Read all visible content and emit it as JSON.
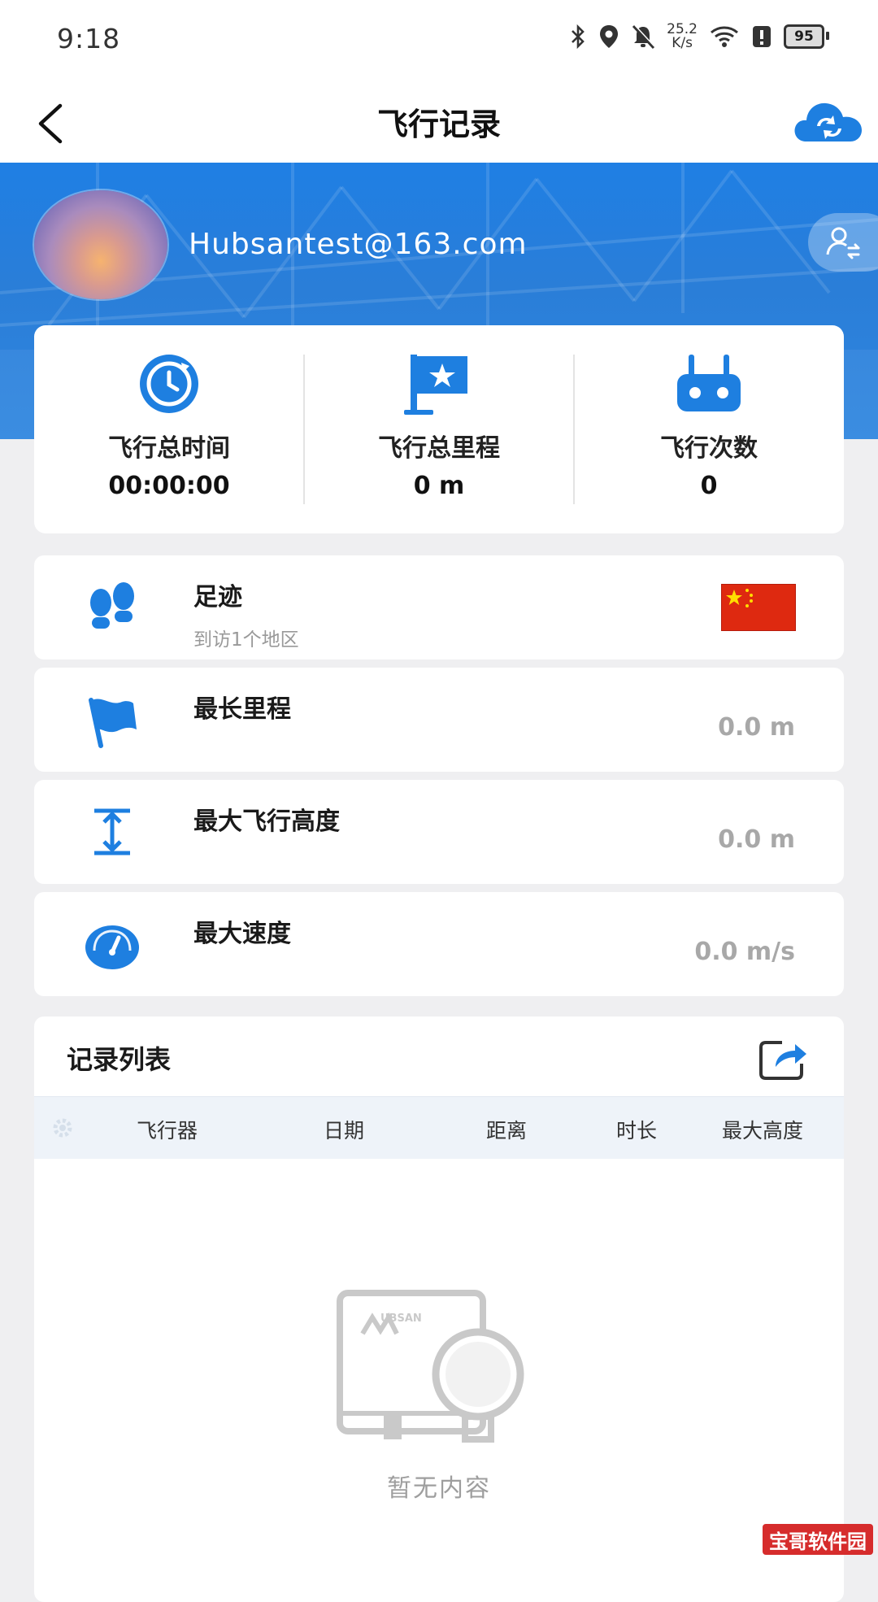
{
  "status_bar": {
    "time": "9:18",
    "net_speed_value": "25.2",
    "net_speed_unit": "K/s",
    "battery": "95"
  },
  "app_bar": {
    "title": "飞行记录"
  },
  "profile": {
    "email": "Hubsantest@163.com"
  },
  "stats": [
    {
      "label": "飞行总时间",
      "value": "00:00:00",
      "icon": "clock-icon"
    },
    {
      "label": "飞行总里程",
      "value": "0 m",
      "icon": "flag-star-icon"
    },
    {
      "label": "飞行次数",
      "value": "0",
      "icon": "remote-controller-icon"
    }
  ],
  "records": {
    "footprint": {
      "title": "足迹",
      "subtitle": "到访1个地区",
      "icon": "footprints-icon"
    },
    "longest_distance": {
      "title": "最长里程",
      "value": "0.0 m",
      "icon": "flag-icon"
    },
    "max_altitude": {
      "title": "最大飞行高度",
      "value": "0.0 m",
      "icon": "altitude-icon"
    },
    "max_speed": {
      "title": "最大速度",
      "value": "0.0 m/s",
      "icon": "speedometer-icon"
    }
  },
  "list": {
    "title": "记录列表",
    "columns": [
      "飞行器",
      "日期",
      "距离",
      "时长",
      "最大高度"
    ],
    "empty_text": "暂无内容",
    "logo_text": "UBSAN"
  },
  "watermark": "宝哥软件园",
  "colors": {
    "accent": "#1e7fe0",
    "flag_red": "#de2910",
    "flag_star": "#ffde00"
  }
}
